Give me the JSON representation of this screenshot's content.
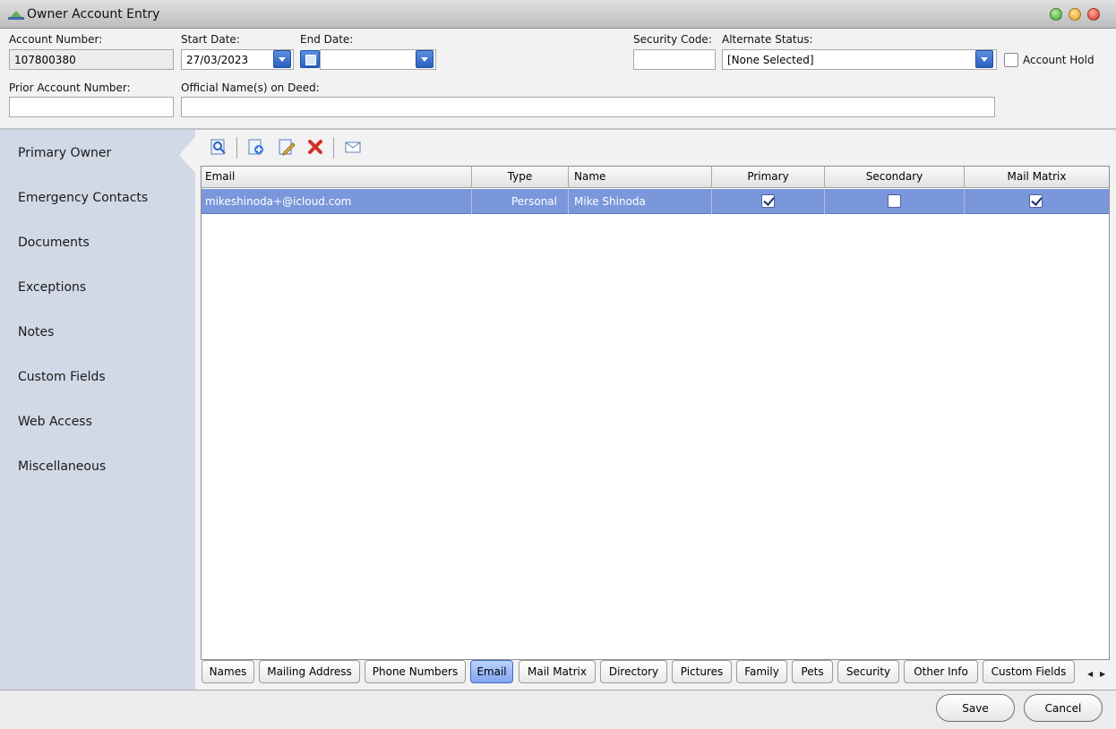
{
  "window": {
    "title": "Owner Account Entry",
    "controls": [
      "minimize-icon",
      "maximize-icon",
      "close-icon"
    ]
  },
  "header": {
    "account_number": {
      "label": "Account Number:",
      "value": "107800380"
    },
    "start_date": {
      "label": "Start Date:",
      "value": "27/03/2023"
    },
    "end_date": {
      "label": "End Date:",
      "value": ""
    },
    "security_code": {
      "label": "Security Code:",
      "value": ""
    },
    "alternate_status": {
      "label": "Alternate Status:",
      "value": "[None Selected]"
    },
    "account_hold": {
      "label": "Account Hold",
      "checked": false
    },
    "prior_account_number": {
      "label": "Prior Account Number:",
      "value": ""
    },
    "official_names": {
      "label": "Official Name(s) on Deed:",
      "value": ""
    }
  },
  "sidebar": {
    "items": [
      {
        "label": "Primary Owner",
        "selected": true
      },
      {
        "label": "Emergency Contacts"
      },
      {
        "label": "Documents"
      },
      {
        "label": "Exceptions"
      },
      {
        "label": "Notes"
      },
      {
        "label": "Custom Fields"
      },
      {
        "label": "Web Access"
      },
      {
        "label": "Miscellaneous"
      }
    ]
  },
  "toolbar": {
    "icons": [
      "view-icon",
      "add-icon",
      "edit-icon",
      "delete-icon",
      "email-icon"
    ]
  },
  "grid": {
    "columns": [
      "Email",
      "Type",
      "Name",
      "Primary",
      "Secondary",
      "Mail Matrix"
    ],
    "rows": [
      {
        "email": "mikeshinoda+@icloud.com",
        "type": "Personal",
        "name": "Mike Shinoda",
        "primary": true,
        "secondary": false,
        "mail_matrix": true
      }
    ]
  },
  "tabs": {
    "items": [
      "Names",
      "Mailing Address",
      "Phone Numbers",
      "Email",
      "Mail Matrix",
      "Directory",
      "Pictures",
      "Family",
      "Pets",
      "Security",
      "Other Info",
      "Custom Fields"
    ],
    "active": "Email"
  },
  "footer": {
    "save_label": "Save",
    "cancel_label": "Cancel"
  },
  "colors": {
    "selected_row": "#7b97db",
    "sidebar_bg": "#d2d9e6",
    "accent": "#2a5fbf"
  }
}
